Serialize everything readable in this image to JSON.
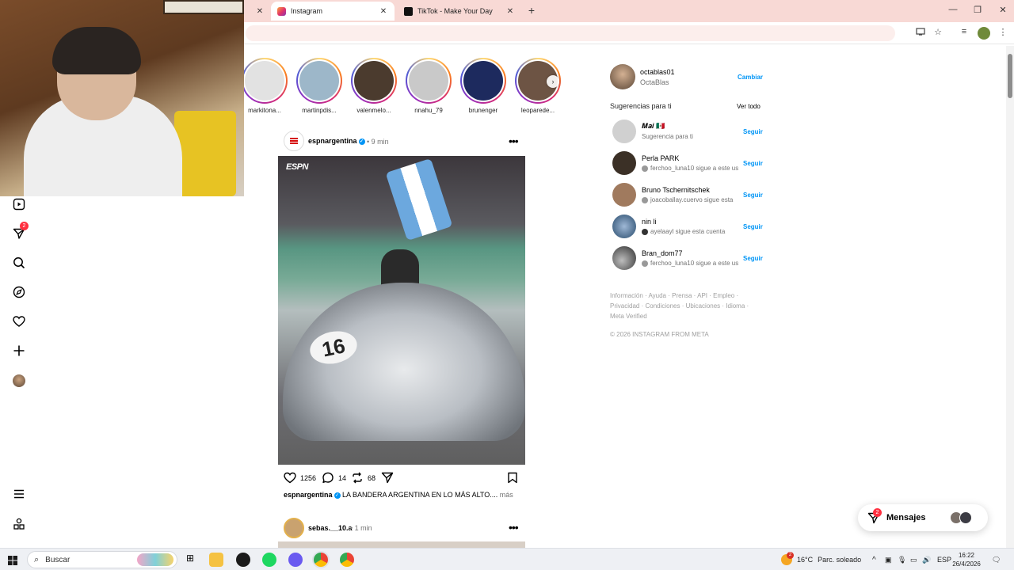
{
  "browser": {
    "tabs": [
      {
        "title": "",
        "active": false
      },
      {
        "title": "Instagram",
        "active": true
      },
      {
        "title": "TikTok - Make Your Day",
        "active": false
      }
    ],
    "new_tab_label": "+"
  },
  "nav": {
    "messages_badge": "2"
  },
  "stories": [
    {
      "user": "markitona...",
      "color": "#d9d9d9"
    },
    {
      "user": "martinpdis...",
      "color": "#9db7c9"
    },
    {
      "user": "valenmelo...",
      "color": "#4b3b2e"
    },
    {
      "user": "nnahu_79",
      "color": "#c9c9c9"
    },
    {
      "user": "brunenger",
      "color": "#1d2a5e"
    },
    {
      "user": "leoparede...",
      "color": "#6d5444"
    }
  ],
  "post": {
    "user": "espnargentina",
    "time": "9 min",
    "image_logo": "ESPN",
    "car_number": "16",
    "likes": "1256",
    "comments": "14",
    "reposts": "68",
    "caption_user": "espnargentina",
    "caption_text": "LA BANDERA ARGENTINA EN LO MÁS ALTO....",
    "caption_more": "más"
  },
  "post2": {
    "user": "sebas.__10.a",
    "time": "1 min"
  },
  "sidebar": {
    "me": {
      "user": "octablas01",
      "name": "OctaBlas",
      "switch_label": "Cambiar"
    },
    "suggestions_heading": "Sugerencias para ti",
    "see_all": "Ver todo",
    "suggestions": [
      {
        "name": "𝑴𝒂𝒊 🇲🇽",
        "sub": "Sugerencia para ti",
        "action": "Seguir",
        "color": "#d0d0d0"
      },
      {
        "name": "Perla PARK",
        "sub": "ferchoo_luna10 sigue a este us",
        "action": "Seguir",
        "color": "#3b3026"
      },
      {
        "name": "Bruno Tschernitschek",
        "sub": "joacoballay.cuervo sigue esta",
        "action": "Seguir",
        "color": "#a07a5e"
      },
      {
        "name": "nin li",
        "sub": "ayelaayl sigue esta cuenta",
        "action": "Seguir",
        "color": "#274a6b"
      },
      {
        "name": "Bran_dom77",
        "sub": "ferchoo_luna10 sigue a este us",
        "action": "Seguir",
        "color": "#2b2b2b"
      }
    ],
    "footer_links": "Información · Ayuda · Prensa · API · Empleo · Privacidad · Condiciones · Ubicaciones · Idioma · Meta Verified",
    "copyright": "© 2026 INSTAGRAM FROM META"
  },
  "messages": {
    "label": "Mensajes",
    "badge": "2"
  },
  "taskbar": {
    "search_placeholder": "Buscar",
    "weather_temp": "16°C",
    "weather_desc": "Parc. soleado",
    "lang": "ESP",
    "time": "16:22",
    "date": "26/4/2026",
    "weather_badge": "2"
  }
}
